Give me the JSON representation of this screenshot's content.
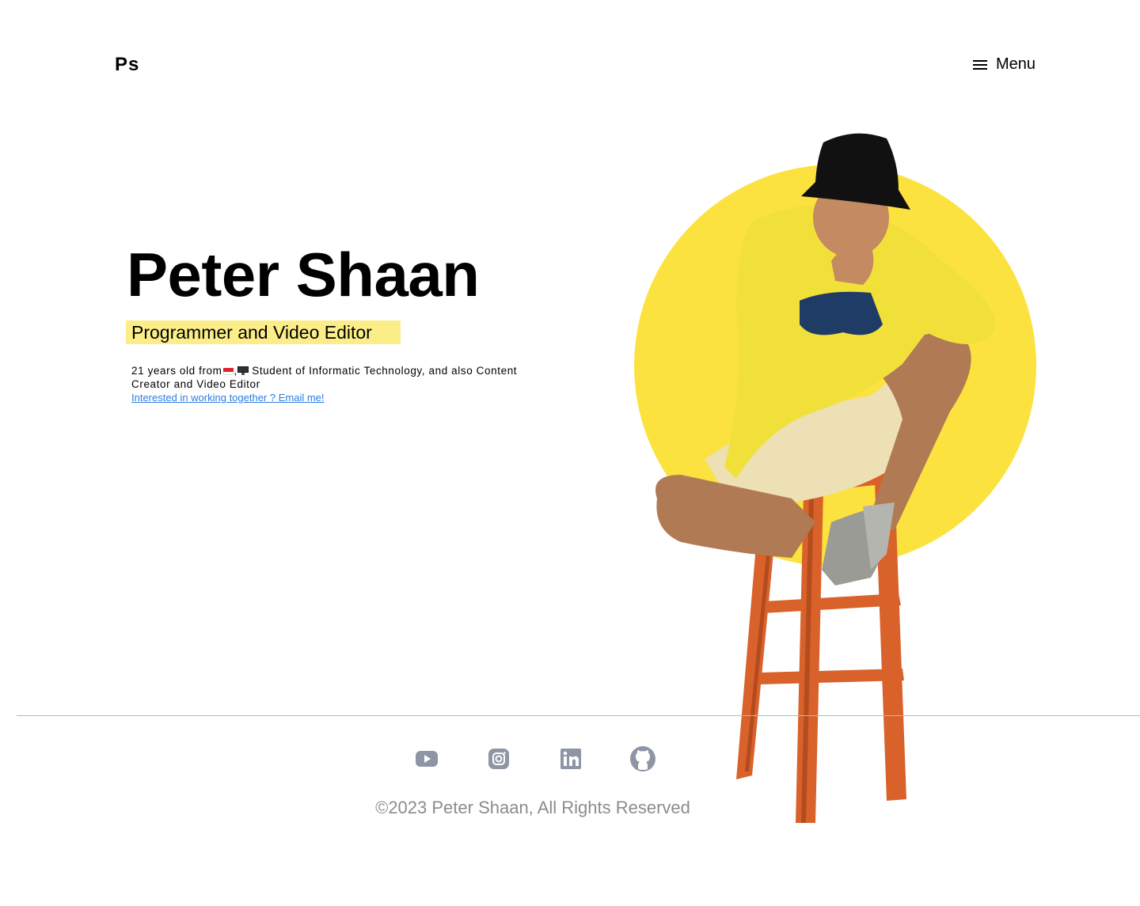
{
  "header": {
    "logo_text": "Ps",
    "menu_label": "Menu",
    "menu_icon": "hamburger-icon"
  },
  "hero": {
    "name": "Peter Shaan",
    "subtitle": "Programmer and Video Editor",
    "highlight_color": "#fbee88",
    "description_part1": "21 years old from",
    "description_part2": " Student of Informatic Technology, and also Content Creator and Video Editor",
    "email_link": "Interested in working together ? Email me!",
    "link_color": "#2d7ce0",
    "accent_color": "#fce23e"
  },
  "footer": {
    "social_icons": [
      "youtube-icon",
      "instagram-icon",
      "linkedin-icon",
      "github-icon"
    ],
    "icon_color": "#8e95a5",
    "copyright": "©2023 Peter Shaan, All Rights Reserved"
  }
}
